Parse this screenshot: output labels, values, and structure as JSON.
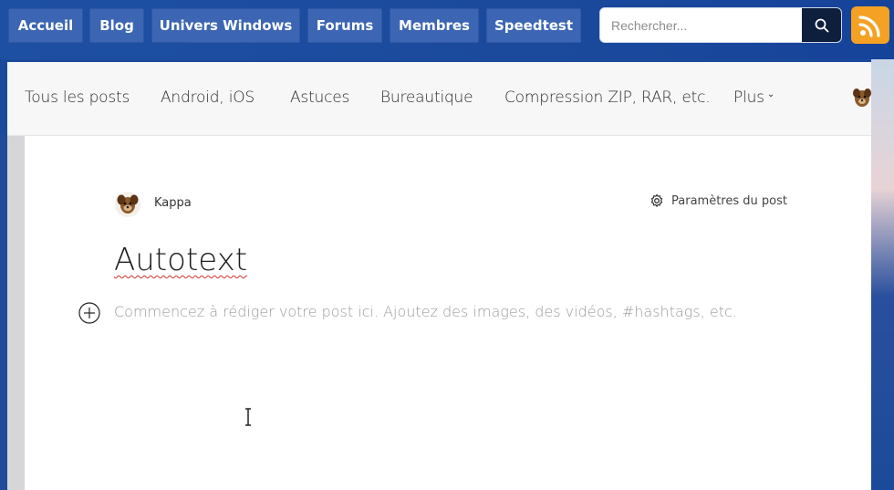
{
  "topnav": {
    "items": [
      {
        "label": "Accueil"
      },
      {
        "label": "Blog"
      },
      {
        "label": "Univers Windows"
      },
      {
        "label": "Forums"
      },
      {
        "label": "Membres"
      },
      {
        "label": "Speedtest"
      }
    ],
    "search": {
      "placeholder": "Rechercher..."
    },
    "colors": {
      "bar": "#1d4fa3",
      "button": "#3c66b3",
      "search_button": "#0d1f3d",
      "rss": "#f5a124"
    },
    "icons": {
      "search": "search-icon",
      "rss": "rss-icon"
    }
  },
  "categories": {
    "items": [
      {
        "label": "Tous les posts"
      },
      {
        "label": "Android, iOS"
      },
      {
        "label": "Astuces"
      },
      {
        "label": "Bureautique"
      },
      {
        "label": "Compression ZIP, RAR, etc."
      },
      {
        "label": "Plus"
      }
    ]
  },
  "editor": {
    "author": "Kappa",
    "settings_label": "Paramètres du post",
    "title": "Autotext",
    "body_placeholder": "Commencez à rédiger votre post ici. Ajoutez des images, des vidéos, #hashtags, etc."
  }
}
